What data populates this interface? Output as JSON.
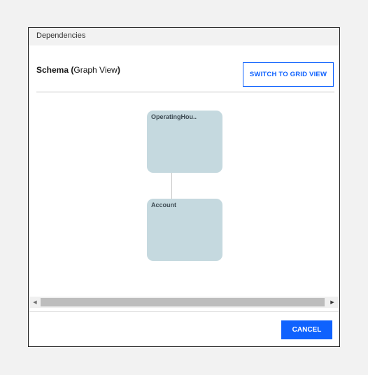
{
  "dialog": {
    "title": "Dependencies"
  },
  "schema": {
    "title_bold": "Schema (",
    "title_normal": "Graph View",
    "title_close": ")"
  },
  "toolbar": {
    "switch_label": "SWITCH TO GRID VIEW"
  },
  "graph": {
    "nodes": [
      {
        "label": "OperatingHou.."
      },
      {
        "label": "Account"
      }
    ]
  },
  "scrollbar": {
    "left_arrow": "◀",
    "right_arrow": "▶"
  },
  "footer": {
    "cancel_label": "CANCEL"
  },
  "colors": {
    "accent": "#0f62fe",
    "node_fill": "#c5d9df",
    "header_bg": "#f2f2f2"
  }
}
